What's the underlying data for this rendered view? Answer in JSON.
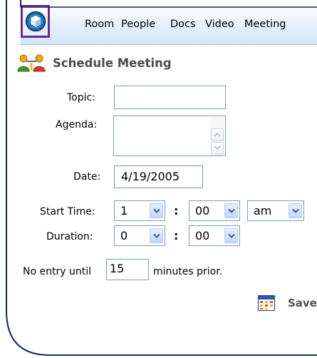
{
  "nav": {
    "items": [
      "Room",
      "People",
      "Docs",
      "Video",
      "Meeting"
    ]
  },
  "heading": {
    "title": "Schedule Meeting"
  },
  "form": {
    "topic_label": "Topic:",
    "topic_value": "",
    "agenda_label": "Agenda:",
    "agenda_value": "",
    "date_label": "Date:",
    "date_value": "4/19/2005",
    "start_time_label": "Start Time:",
    "start_hour": "1",
    "start_minute": "00",
    "start_ampm": "am",
    "duration_label": "Duration:",
    "duration_hours": "0",
    "duration_minutes": "00",
    "time_separator": ":",
    "no_entry_prefix": "No entry until",
    "no_entry_minutes": "15",
    "no_entry_suffix": "minutes prior."
  },
  "actions": {
    "save_label": "Save"
  },
  "colors": {
    "frame_border": "#0e2d56",
    "logo_border": "#6a2795",
    "nav_gradient_top": "#fafdff",
    "nav_gradient_bottom": "#d4e5f8",
    "input_border": "#7f9db9",
    "heading_text": "#4d4d4d"
  },
  "icons": {
    "logo": "cube-logo-icon",
    "heading": "meeting-people-icon",
    "save": "calendar-grid-icon",
    "dropdown": "chevron-down-icon"
  }
}
